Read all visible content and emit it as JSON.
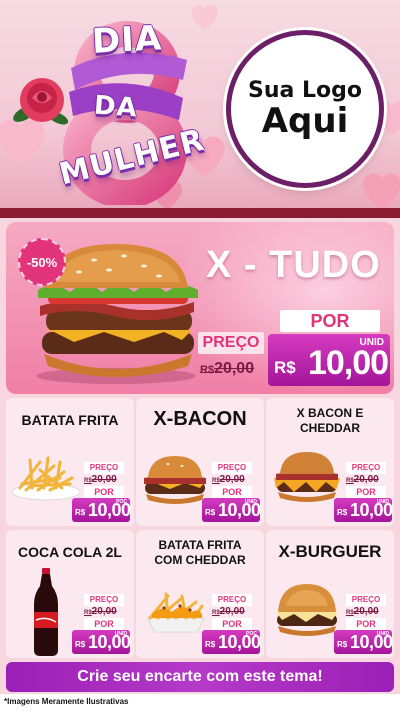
{
  "header": {
    "title_words": [
      "DIA",
      "DA",
      "MULHER"
    ],
    "logo_line1": "Sua Logo",
    "logo_line2": "Aqui"
  },
  "featured": {
    "badge": "-50%",
    "name": "X - TUDO",
    "preco_label": "PREÇO",
    "old_currency": "R$",
    "old_amount": "20,00",
    "por_label": "POR",
    "currency": "R$",
    "amount": "10,00",
    "unit": "UNID"
  },
  "products": [
    {
      "name": "BATATA FRITA",
      "preco_label": "PREÇO",
      "old_currency": "R$",
      "old_amount": "20,00",
      "por_label": "POR",
      "currency": "R$",
      "amount": "10,00",
      "unit": "POÇ"
    },
    {
      "name": "X-BACON",
      "preco_label": "PREÇO",
      "old_currency": "R$",
      "old_amount": "20,00",
      "por_label": "POR",
      "currency": "R$",
      "amount": "10,00",
      "unit": "UNID"
    },
    {
      "name": "X BACON E CHEDDAR",
      "preco_label": "PREÇO",
      "old_currency": "R$",
      "old_amount": "20,00",
      "por_label": "POR",
      "currency": "R$",
      "amount": "10,00",
      "unit": "UNID"
    },
    {
      "name": "COCA COLA 2L",
      "preco_label": "PREÇO",
      "old_currency": "R$",
      "old_amount": "20,00",
      "por_label": "POR",
      "currency": "R$",
      "amount": "10,00",
      "unit": "UNID"
    },
    {
      "name": "BATATA FRITA COM CHEDDAR",
      "preco_label": "PREÇO",
      "old_currency": "R$",
      "old_amount": "20,00",
      "por_label": "POR",
      "currency": "R$",
      "amount": "10,00",
      "unit": "POÇ"
    },
    {
      "name": "X-BURGUER",
      "preco_label": "PREÇO",
      "old_currency": "R$",
      "old_amount": "20,00",
      "por_label": "POR",
      "currency": "R$",
      "amount": "10,00",
      "unit": "UNID"
    }
  ],
  "cta": "Crie seu encarte com este tema!",
  "disclaimer": "*Imagens Meramente Ilustrativas",
  "colors": {
    "accent": "#e2347a",
    "price_purple": "#a4159a",
    "logo_border": "#6b1f66",
    "band": "#8a1d34"
  }
}
